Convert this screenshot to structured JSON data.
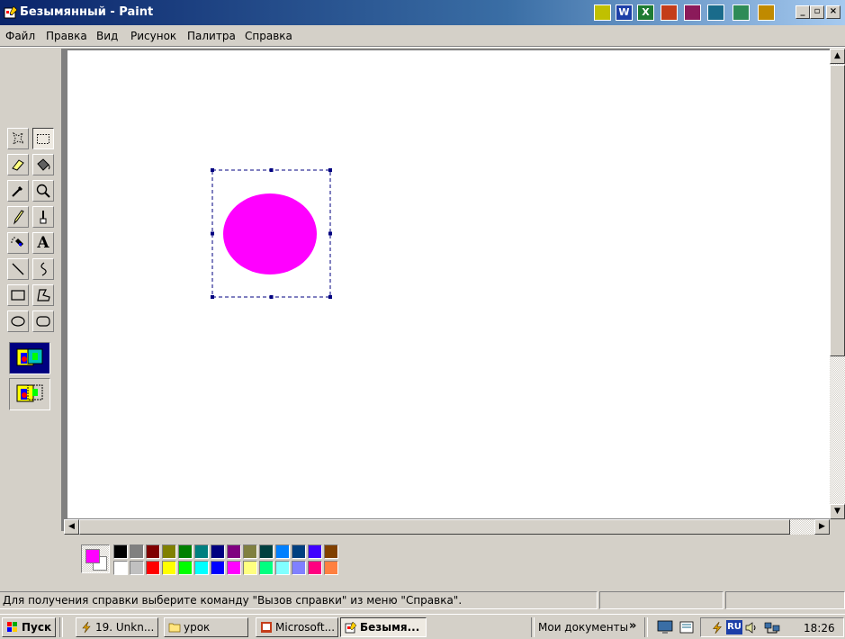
{
  "window": {
    "title": "Безымянный - Paint",
    "title_icon": "paint-app-icon",
    "controls": {
      "minimize": "_",
      "restore": "▫",
      "close": "×"
    }
  },
  "quick_apps": [
    {
      "name": "app-icon-1",
      "color": "#c0c000"
    },
    {
      "name": "word-icon",
      "color": "#1c3fa8",
      "glyph": "W"
    },
    {
      "name": "excel-icon",
      "color": "#1e7b32",
      "glyph": "X"
    },
    {
      "name": "powerpoint-icon",
      "color": "#c43d1a"
    },
    {
      "name": "access-icon",
      "color": "#8b1a5a"
    },
    {
      "name": "outlook-icon",
      "color": "#1a6b8b"
    },
    {
      "name": "binder-icon",
      "color": "#2e8b57"
    },
    {
      "name": "office-app-icon",
      "color": "#c08a00"
    }
  ],
  "menu": {
    "items": [
      "Файл",
      "Правка",
      "Вид",
      "Рисунок",
      "Палитра",
      "Справка"
    ]
  },
  "tools": [
    {
      "name": "free-select-tool",
      "icon": "free-select-icon"
    },
    {
      "name": "rect-select-tool",
      "icon": "rect-select-icon",
      "selected": true
    },
    {
      "name": "eraser-tool",
      "icon": "eraser-icon"
    },
    {
      "name": "fill-tool",
      "icon": "paint-bucket-icon"
    },
    {
      "name": "color-picker-tool",
      "icon": "eyedropper-icon"
    },
    {
      "name": "magnifier-tool",
      "icon": "magnifier-icon"
    },
    {
      "name": "pencil-tool",
      "icon": "pencil-icon"
    },
    {
      "name": "brush-tool",
      "icon": "brush-icon"
    },
    {
      "name": "airbrush-tool",
      "icon": "airbrush-icon"
    },
    {
      "name": "text-tool",
      "icon": "text-icon",
      "glyph": "A"
    },
    {
      "name": "line-tool",
      "icon": "line-icon"
    },
    {
      "name": "curve-tool",
      "icon": "curve-icon"
    },
    {
      "name": "rectangle-tool",
      "icon": "rectangle-icon"
    },
    {
      "name": "polygon-tool",
      "icon": "polygon-icon"
    },
    {
      "name": "ellipse-tool",
      "icon": "ellipse-icon"
    },
    {
      "name": "rounded-rect-tool",
      "icon": "rounded-rect-icon"
    }
  ],
  "canvas": {
    "shape_color": "#ff00ff",
    "selection_color": "#000080"
  },
  "colors": {
    "foreground": "#ff00ff",
    "background": "#ffffff",
    "palette_top": [
      "#000000",
      "#808080",
      "#800000",
      "#808000",
      "#008000",
      "#008080",
      "#000080",
      "#800080",
      "#808040",
      "#004040",
      "#0080ff",
      "#004080",
      "#4000ff",
      "#804000"
    ],
    "palette_bottom": [
      "#ffffff",
      "#c0c0c0",
      "#ff0000",
      "#ffff00",
      "#00ff00",
      "#00ffff",
      "#0000ff",
      "#ff00ff",
      "#ffff80",
      "#00ff80",
      "#80ffff",
      "#8080ff",
      "#ff0080",
      "#ff8040"
    ]
  },
  "status": {
    "help_text": "Для получения справки выберите команду \"Вызов справки\" из меню \"Справка\"."
  },
  "taskbar": {
    "start_label": "Пуск",
    "tasks": [
      {
        "label": "19. Unkn...",
        "icon": "winamp-icon"
      },
      {
        "label": "урок",
        "icon": "folder-icon"
      },
      {
        "label": "Microsoft...",
        "icon": "powerpoint-icon"
      },
      {
        "label": "Безымя...",
        "icon": "paint-app-icon",
        "active": true
      }
    ],
    "documents_label": "Мои документы",
    "documents_chevron": "»",
    "language": "RU",
    "clock": "18:26"
  }
}
